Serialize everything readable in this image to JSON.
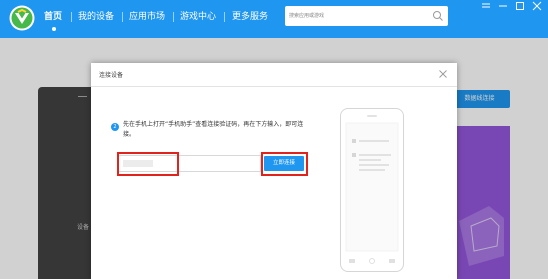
{
  "nav": {
    "items": [
      {
        "label": "首页",
        "active": true
      },
      {
        "label": "我的设备"
      },
      {
        "label": "应用市场"
      },
      {
        "label": "游戏中心"
      },
      {
        "label": "更多服务"
      }
    ],
    "search_placeholder": "搜索应用或游戏",
    "window_controls": [
      "menu-icon",
      "minimize-icon",
      "maximize-icon",
      "close-icon"
    ]
  },
  "background": {
    "phone_label": "设备",
    "wireless_button": "数据线连接"
  },
  "dialog": {
    "title": "连接设备",
    "step_number": "2",
    "instruction": "先在手机上打开“手机助手”查看连接验证码，再在下方输入，即可连接。",
    "code_placeholder": "",
    "connect_button": "立即连接"
  },
  "colors": {
    "accent": "#1f96f0",
    "highlight": "#e0241d",
    "card": "#9457dc"
  }
}
